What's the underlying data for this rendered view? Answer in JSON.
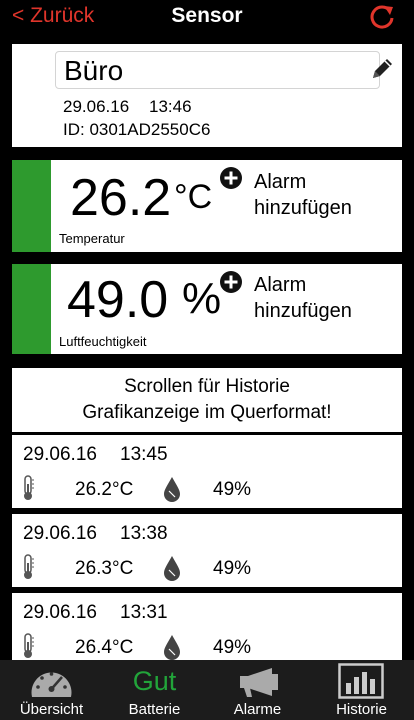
{
  "header": {
    "back_label": "< Zurück",
    "title": "Sensor",
    "accent": "#e0352b"
  },
  "sensor": {
    "name": "Büro",
    "date": "29.06.16",
    "time": "13:46",
    "id_line": "ID: 0301AD2550C6"
  },
  "temperature": {
    "value": "26.2",
    "unit": "°C",
    "label": "Temperatur",
    "alarm_line1": "Alarm",
    "alarm_line2": "hinzufügen"
  },
  "humidity": {
    "value": "49.0",
    "unit": "%",
    "label": "Luftfeuchtigkeit",
    "alarm_line1": "Alarm",
    "alarm_line2": "hinzufügen"
  },
  "history": {
    "header_line1": "Scrollen für Historie",
    "header_line2": "Grafikanzeige im Querformat!",
    "rows": [
      {
        "date": "29.06.16",
        "time": "13:45",
        "temp": "26.2°C",
        "hum": "49%"
      },
      {
        "date": "29.06.16",
        "time": "13:38",
        "temp": "26.3°C",
        "hum": "49%"
      },
      {
        "date": "29.06.16",
        "time": "13:31",
        "temp": "26.4°C",
        "hum": "49%"
      }
    ]
  },
  "tabs": {
    "overview": "Übersicht",
    "battery_status": "Gut",
    "battery": "Batterie",
    "alarms": "Alarme",
    "history": "Historie"
  },
  "colors": {
    "status_green": "#2e9a2e",
    "battery_green": "#22a43a"
  },
  "icons": [
    "refresh-icon",
    "pencil-icon",
    "plus-circle-icon",
    "thermometer-icon",
    "humidity-drop-icon",
    "gauge-icon",
    "megaphone-icon",
    "bar-chart-icon"
  ]
}
